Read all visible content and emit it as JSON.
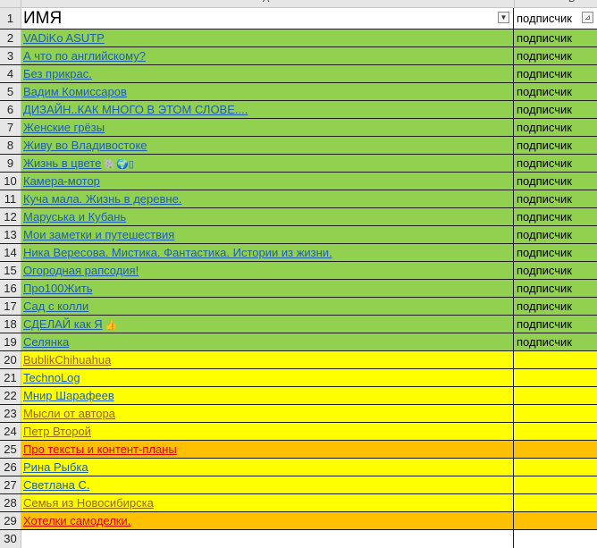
{
  "columns": {
    "a_letter": "A",
    "b_letter": "B"
  },
  "header": {
    "row_num": "1",
    "col_a": "ИМЯ",
    "col_b": "подписчик"
  },
  "rows": [
    {
      "n": "2",
      "name": "VADiKo ASUTP",
      "b": "подписчик",
      "fill": "green",
      "link": "blue"
    },
    {
      "n": "3",
      "name": "А что по английскому?",
      "b": "подписчик",
      "fill": "green",
      "link": "blue"
    },
    {
      "n": "4",
      "name": "Без прикрас.",
      "b": "подписчик",
      "fill": "green",
      "link": "blue"
    },
    {
      "n": "5",
      "name": "Вадим Комиссаров",
      "b": "подписчик",
      "fill": "green",
      "link": "blue"
    },
    {
      "n": "6",
      "name": "ДИЗАЙН..КАК МНОГО В ЭТОМ СЛОВЕ....",
      "b": "подписчик",
      "fill": "green",
      "link": "blue"
    },
    {
      "n": "7",
      "name": "Женские грёзы",
      "b": "подписчик",
      "fill": "green",
      "link": "blue"
    },
    {
      "n": "8",
      "name": "Живу во Владивостоке",
      "b": "подписчик",
      "fill": "green",
      "link": "blue"
    },
    {
      "n": "9",
      "name": "Жизнь в цвете",
      "b": "подписчик",
      "fill": "green",
      "link": "blue",
      "emoji": "🐘🌍▯"
    },
    {
      "n": "10",
      "name": "Камера-мотор",
      "b": "подписчик",
      "fill": "green",
      "link": "blue"
    },
    {
      "n": "11",
      "name": "Куча мала. Жизнь в деревне.",
      "b": "подписчик",
      "fill": "green",
      "link": "blue"
    },
    {
      "n": "12",
      "name": "Маруська и Кубань",
      "b": "подписчик",
      "fill": "green",
      "link": "blue"
    },
    {
      "n": "13",
      "name": "Мои заметки и путешествия",
      "b": "подписчик",
      "fill": "green",
      "link": "blue"
    },
    {
      "n": "14",
      "name": "Ника Вересова. Мистика. Фантастика. Истории из жизни.",
      "b": "подписчик",
      "fill": "green",
      "link": "blue"
    },
    {
      "n": "15",
      "name": "Огородная рапсодия!",
      "b": "подписчик",
      "fill": "green",
      "link": "blue"
    },
    {
      "n": "16",
      "name": "Про100Жить",
      "b": "подписчик",
      "fill": "green",
      "link": "blue"
    },
    {
      "n": "17",
      "name": "Сад с колли",
      "b": "подписчик",
      "fill": "green",
      "link": "blue"
    },
    {
      "n": "18",
      "name": "СДЕЛАЙ как Я",
      "b": "подписчик",
      "fill": "green",
      "link": "blue",
      "emoji": "👍"
    },
    {
      "n": "19",
      "name": "Селянка",
      "b": "подписчик",
      "fill": "green",
      "link": "blue"
    },
    {
      "n": "20",
      "name": "BublikChihuahua",
      "b": "",
      "fill": "yellow",
      "link": "brown"
    },
    {
      "n": "21",
      "name": "TechnoLog",
      "b": "",
      "fill": "yellow",
      "link": "blue"
    },
    {
      "n": "22",
      "name": "Мнир Шарафеев",
      "b": "",
      "fill": "yellow",
      "link": "blue"
    },
    {
      "n": "23",
      "name": "Мысли от автора",
      "b": "",
      "fill": "yellow",
      "link": "brown"
    },
    {
      "n": "24",
      "name": "Петр Второй",
      "b": "",
      "fill": "yellow",
      "link": "brown"
    },
    {
      "n": "25",
      "name": "Про тексты и контент-планы",
      "b": "",
      "fill": "orange",
      "link": "red"
    },
    {
      "n": "26",
      "name": "Рина Рыбка",
      "b": "",
      "fill": "yellow",
      "link": "blue"
    },
    {
      "n": "27",
      "name": "Светлана С.",
      "b": "",
      "fill": "yellow",
      "link": "blue"
    },
    {
      "n": "28",
      "name": "Семья из Новосибирска",
      "b": "",
      "fill": "yellow",
      "link": "brown"
    },
    {
      "n": "29",
      "name": "Хотелки самоделки.",
      "b": "",
      "fill": "orange",
      "link": "red"
    }
  ],
  "empty_row": {
    "n": "30"
  },
  "colors": {
    "green": "#92d050",
    "yellow": "#ffff00",
    "orange": "#ffc000"
  }
}
